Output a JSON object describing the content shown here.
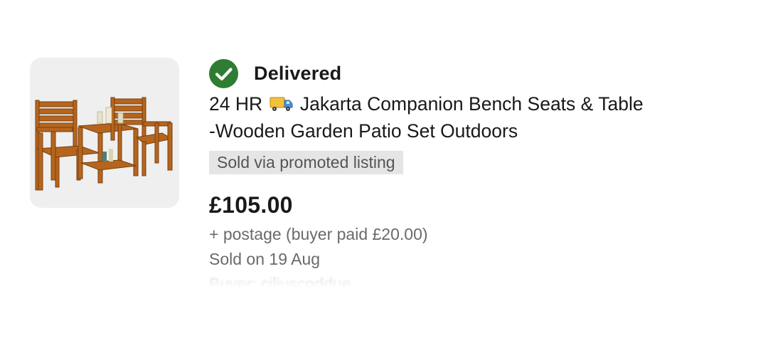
{
  "order": {
    "status": "Delivered",
    "status_icon": "check-circle-icon",
    "status_color": "#2e7d32",
    "title_line1_prefix": "24 HR",
    "title_emoji_icon": "delivery-truck-icon",
    "title_line1_suffix": "Jakarta Companion Bench Seats & Table",
    "title_line2": "-Wooden Garden Patio Set Outdoors",
    "promo_badge": "Sold via promoted listing",
    "price": "£105.00",
    "postage": "+ postage (buyer paid £20.00)",
    "sold_date": "Sold on 19 Aug",
    "buyer": "Buyer: ciliuscoddue"
  },
  "thumbnail": {
    "image_icon": "wooden-bench-set-image",
    "background": "#efefef"
  }
}
